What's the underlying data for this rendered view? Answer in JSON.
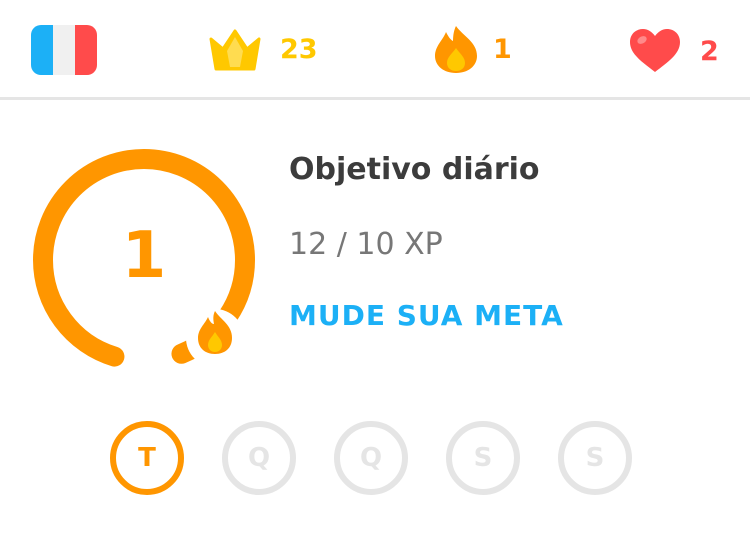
{
  "topbar": {
    "flag_icon": "france-flag-icon",
    "crowns": {
      "icon": "crown-icon",
      "count": "23",
      "color": "#ffc800"
    },
    "streak": {
      "icon": "flame-icon",
      "count": "1",
      "color": "#ff9600"
    },
    "hearts": {
      "icon": "heart-icon",
      "count": "2",
      "color": "#ff4b4b"
    }
  },
  "daily_goal": {
    "streak_count": "1",
    "title": "Objetivo diário",
    "progress_text": "12 / 10 XP",
    "xp_current": 12,
    "xp_goal": 10,
    "change_goal_label": "MUDE SUA META"
  },
  "week": {
    "days": [
      {
        "label": "T",
        "active": true
      },
      {
        "label": "Q",
        "active": false
      },
      {
        "label": "Q",
        "active": false
      },
      {
        "label": "S",
        "active": false
      },
      {
        "label": "S",
        "active": false
      }
    ]
  },
  "colors": {
    "orange": "#ff9600",
    "gold": "#ffc800",
    "red": "#ff4b4b",
    "blue": "#1cb0f6",
    "gray_border": "#e5e5e5",
    "text_dark": "#3c3c3c",
    "text_gray": "#777777"
  }
}
